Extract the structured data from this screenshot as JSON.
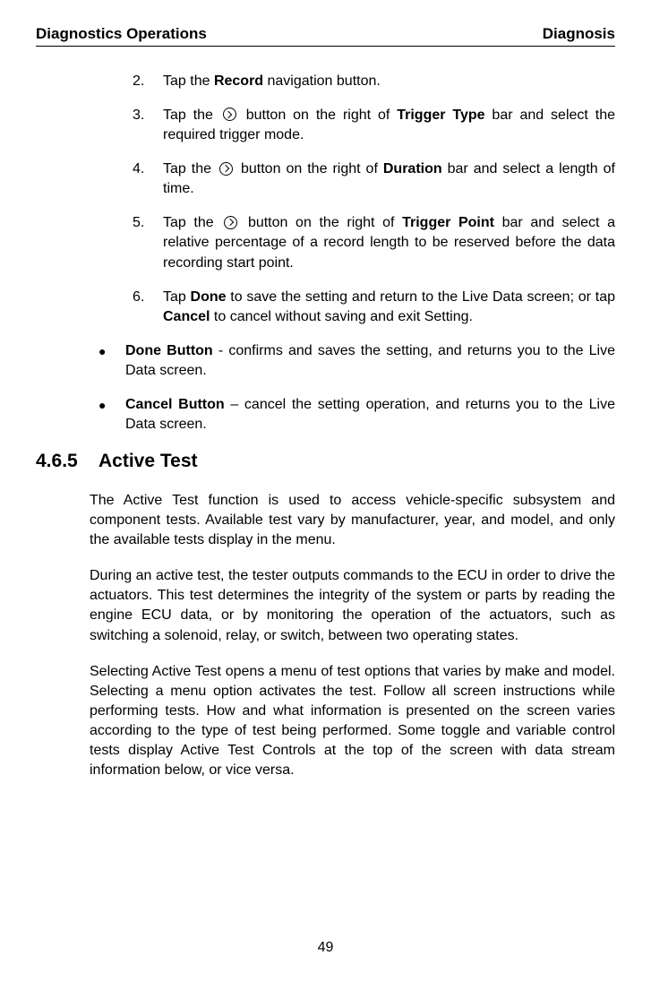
{
  "header": {
    "left": "Diagnostics Operations",
    "right": "Diagnosis"
  },
  "steps": {
    "s2": {
      "num": "2.",
      "t1": "Tap the ",
      "b1": "Record",
      "t2": " navigation button."
    },
    "s3": {
      "num": "3.",
      "t1": "Tap the ",
      "t2": " button on the right of ",
      "b1": "Trigger Type",
      "t3": " bar and select the required trigger mode."
    },
    "s4": {
      "num": "4.",
      "t1": "Tap the ",
      "t2": " button on the right of ",
      "b1": "Duration",
      "t3": " bar and select a length of time."
    },
    "s5": {
      "num": "5.",
      "t1": "Tap the ",
      "t2": " button on the right of ",
      "b1": "Trigger Point",
      "t3": " bar and select a relative percentage of a record length to be reserved before the data recording start point."
    },
    "s6": {
      "num": "6.",
      "t1": "Tap ",
      "b1": "Done",
      "t2": " to save the setting and return to the Live Data screen; or tap ",
      "b2": "Cancel",
      "t3": " to cancel without saving and exit Setting."
    }
  },
  "bullets": {
    "b1": {
      "head": "Done Button",
      "rest": " - confirms and saves the setting, and returns you to the Live Data screen."
    },
    "b2": {
      "head": "Cancel Button",
      "rest": " – cancel the setting operation, and returns you to the Live Data screen."
    }
  },
  "section": {
    "num": "4.6.5",
    "title": "Active Test"
  },
  "paras": {
    "p1": "The Active Test function is used to access vehicle-specific subsystem and component tests. Available test vary by manufacturer, year, and model, and only the available tests display in the menu.",
    "p2": "During an active test, the tester outputs commands to the ECU in order to drive the actuators. This test determines the integrity of the system or parts by reading the engine ECU data, or by monitoring the operation of the actuators, such as switching a solenoid, relay, or switch, between two operating states.",
    "p3": "Selecting Active Test opens a menu of test options that varies by make and model. Selecting a menu option activates the test. Follow all screen instructions while performing tests. How and what information is presented on the screen varies according to the type of test being performed. Some toggle and variable control tests display Active Test Controls at the top of the screen with data stream information below, or vice versa."
  },
  "pageNumber": "49"
}
